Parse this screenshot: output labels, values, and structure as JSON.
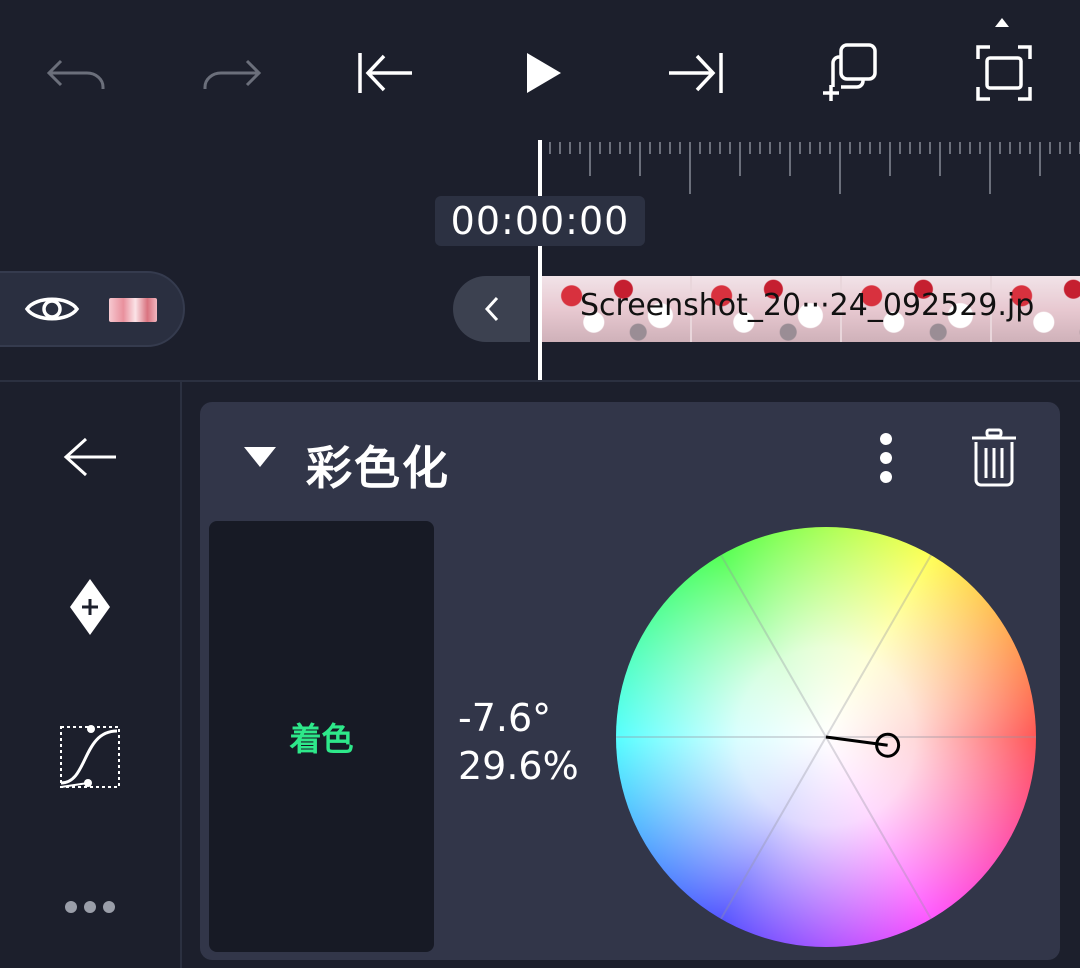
{
  "toolbar": {
    "buttons": [
      {
        "name": "undo-button",
        "icon": "undo-icon"
      },
      {
        "name": "redo-button",
        "icon": "redo-icon"
      },
      {
        "name": "jump-to-start-button",
        "icon": "skip-start-icon"
      },
      {
        "name": "play-button",
        "icon": "play-icon"
      },
      {
        "name": "jump-to-end-button",
        "icon": "skip-end-icon"
      },
      {
        "name": "add-layer-button",
        "icon": "add-copy-icon"
      },
      {
        "name": "fullscreen-button",
        "icon": "fullscreen-icon"
      }
    ]
  },
  "timeline": {
    "timecode": "00:00:00",
    "clip_name": "Screenshot_20···24_092529.jp"
  },
  "sidebar": {
    "items": [
      {
        "name": "back-button",
        "icon": "arrow-left-icon"
      },
      {
        "name": "add-keyframe-button",
        "icon": "keyframe-add-icon"
      },
      {
        "name": "easing-curve-button",
        "icon": "curve-icon"
      },
      {
        "name": "more-options-button",
        "icon": "ellipsis-icon"
      }
    ]
  },
  "effect": {
    "title": "彩色化",
    "mode_label": "着色",
    "hue": "-7.6°",
    "saturation": "29.6%",
    "hue_value": -7.6,
    "saturation_value": 29.6
  },
  "colors": {
    "background": "#1c1f2c",
    "panel": "#323649",
    "accent_green": "#2ee88a"
  }
}
